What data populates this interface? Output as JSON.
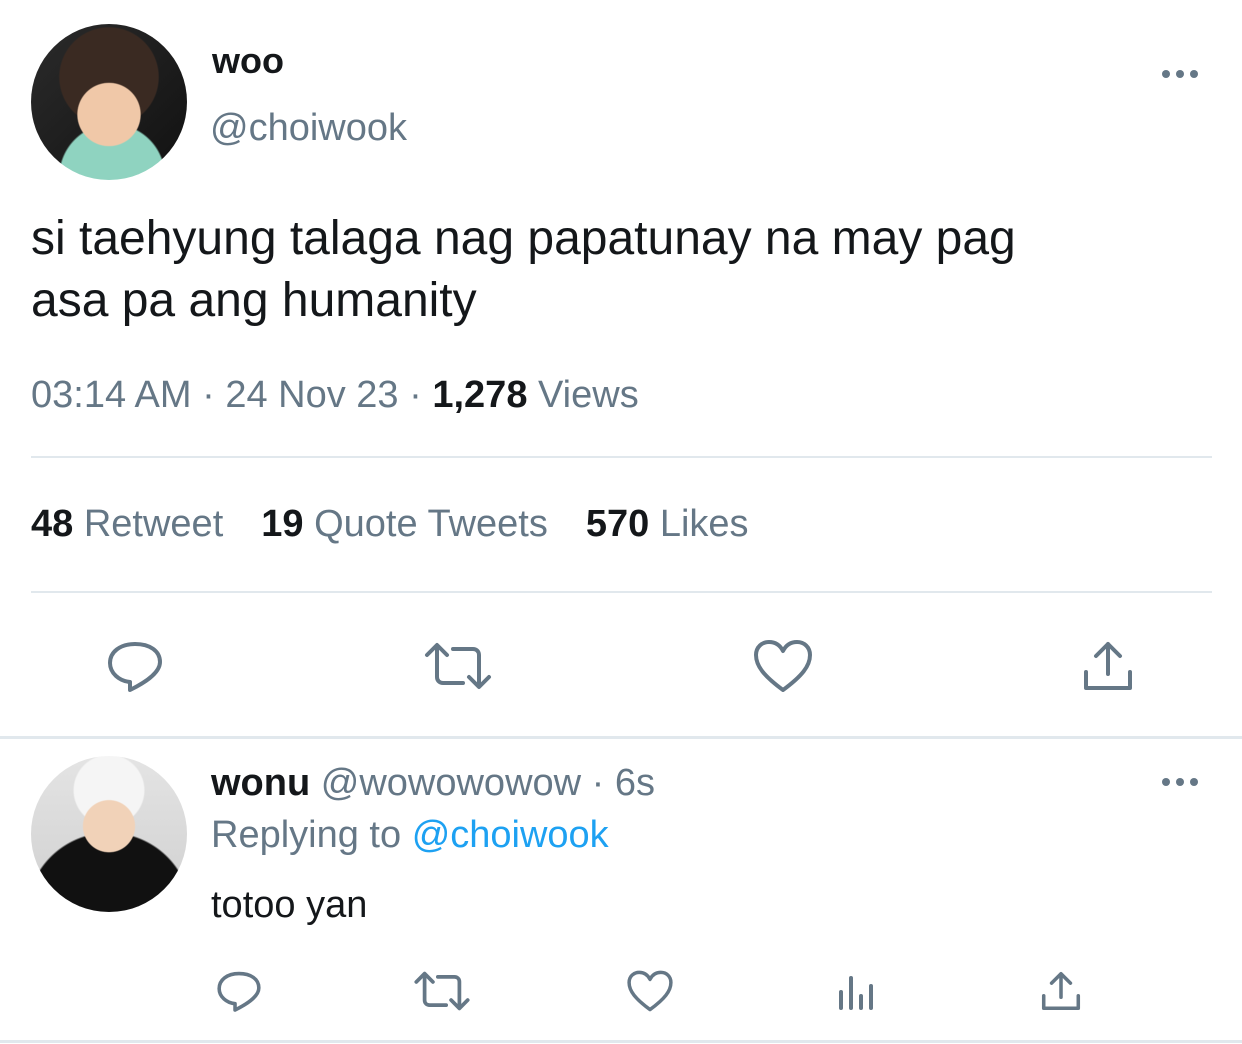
{
  "main_tweet": {
    "display_name": "woo",
    "handle": "@choiwook",
    "text_line1": "si taehyung talaga nag papatunay na may pag",
    "text_line2": "asa pa ang humanity",
    "time": "03:14 AM",
    "date": "24 Nov 23",
    "views_count": "1,278",
    "views_label": "Views",
    "retweets_count": "48",
    "retweets_label": "Retweet",
    "quotes_count": "19",
    "quotes_label": "Quote Tweets",
    "likes_count": "570",
    "likes_label": "Likes",
    "separator": "·"
  },
  "reply": {
    "display_name": "wonu",
    "handle": "@wowowowow",
    "separator": "·",
    "age": "6s",
    "replying_prefix": "Replying to",
    "replying_handle": "@choiwook",
    "text": "totoo yan"
  },
  "icons": {
    "more": "more-horizontal-icon",
    "reply": "reply-bubble-icon",
    "retweet": "retweet-icon",
    "like": "heart-icon",
    "share": "share-upload-icon",
    "analytics": "analytics-bars-icon"
  },
  "colors": {
    "text": "#14171a",
    "secondary": "#657786",
    "link": "#1da1f2",
    "divider": "#e1e8ed"
  }
}
